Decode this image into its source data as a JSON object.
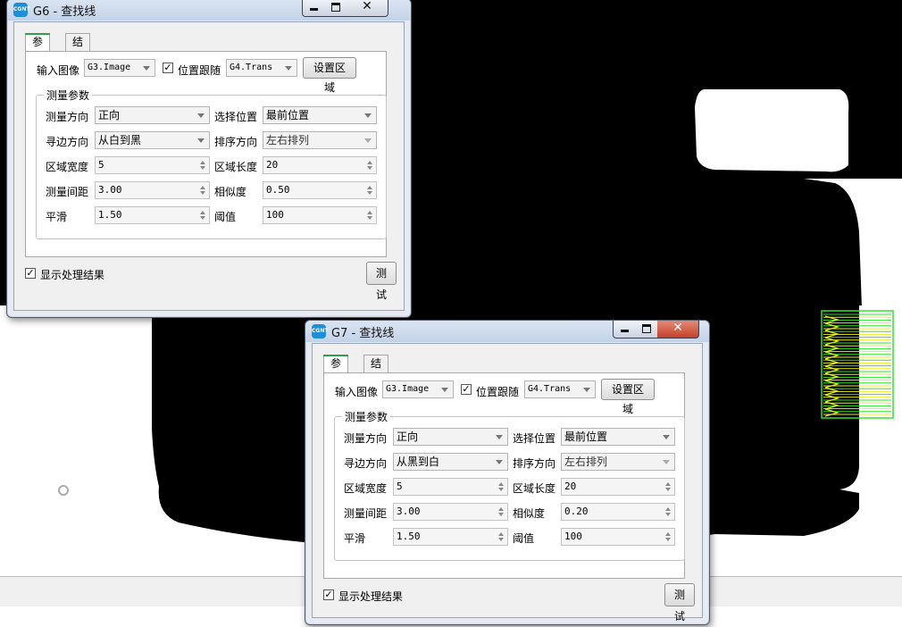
{
  "colors": {
    "background_image": "#000000",
    "overlay_green": "#2ee52e",
    "overlay_yellow": "#e8ef1c",
    "close_button_red": "#c8432c"
  },
  "windows": [
    {
      "id": "g6",
      "title": "G6 - 查找线",
      "tabs": [
        "参数",
        "结果"
      ],
      "active_tab": "参数",
      "input_image_label": "输入图像",
      "input_image_value": "G3.Image",
      "position_follow_label": "位置跟随",
      "position_follow_checked": true,
      "position_follow_value": "G4.Trans",
      "set_region_label": "设置区域",
      "group_title": "测量参数",
      "measure_direction_label": "测量方向",
      "measure_direction_value": "正向",
      "select_position_label": "选择位置",
      "select_position_value": "最前位置",
      "edge_direction_label": "寻边方向",
      "edge_direction_value": "从白到黑",
      "sort_direction_label": "排序方向",
      "sort_direction_value": "左右排列",
      "region_width_label": "区域宽度",
      "region_width_value": "5",
      "region_length_label": "区域长度",
      "region_length_value": "20",
      "measure_spacing_label": "测量间距",
      "measure_spacing_value": "3.00",
      "similarity_label": "相似度",
      "similarity_value": "0.50",
      "smooth_label": "平滑",
      "smooth_value": "1.50",
      "threshold_label": "阈值",
      "threshold_value": "100",
      "show_result_label": "显示处理结果",
      "show_result_checked": true,
      "test_label": "测试"
    },
    {
      "id": "g7",
      "title": "G7 - 查找线",
      "tabs": [
        "参数",
        "结果"
      ],
      "active_tab": "参数",
      "input_image_label": "输入图像",
      "input_image_value": "G3.Image",
      "position_follow_label": "位置跟随",
      "position_follow_checked": true,
      "position_follow_value": "G4.Trans",
      "set_region_label": "设置区域",
      "group_title": "测量参数",
      "measure_direction_label": "测量方向",
      "measure_direction_value": "正向",
      "select_position_label": "选择位置",
      "select_position_value": "最前位置",
      "edge_direction_label": "寻边方向",
      "edge_direction_value": "从黑到白",
      "sort_direction_label": "排序方向",
      "sort_direction_value": "左右排列",
      "region_width_label": "区域宽度",
      "region_width_value": "5",
      "region_length_label": "区域长度",
      "region_length_value": "20",
      "measure_spacing_label": "测量间距",
      "measure_spacing_value": "3.00",
      "similarity_label": "相似度",
      "similarity_value": "0.20",
      "smooth_label": "平滑",
      "smooth_value": "1.50",
      "threshold_label": "阈值",
      "threshold_value": "100",
      "show_result_label": "显示处理结果",
      "show_result_checked": true,
      "test_label": "测试"
    }
  ]
}
